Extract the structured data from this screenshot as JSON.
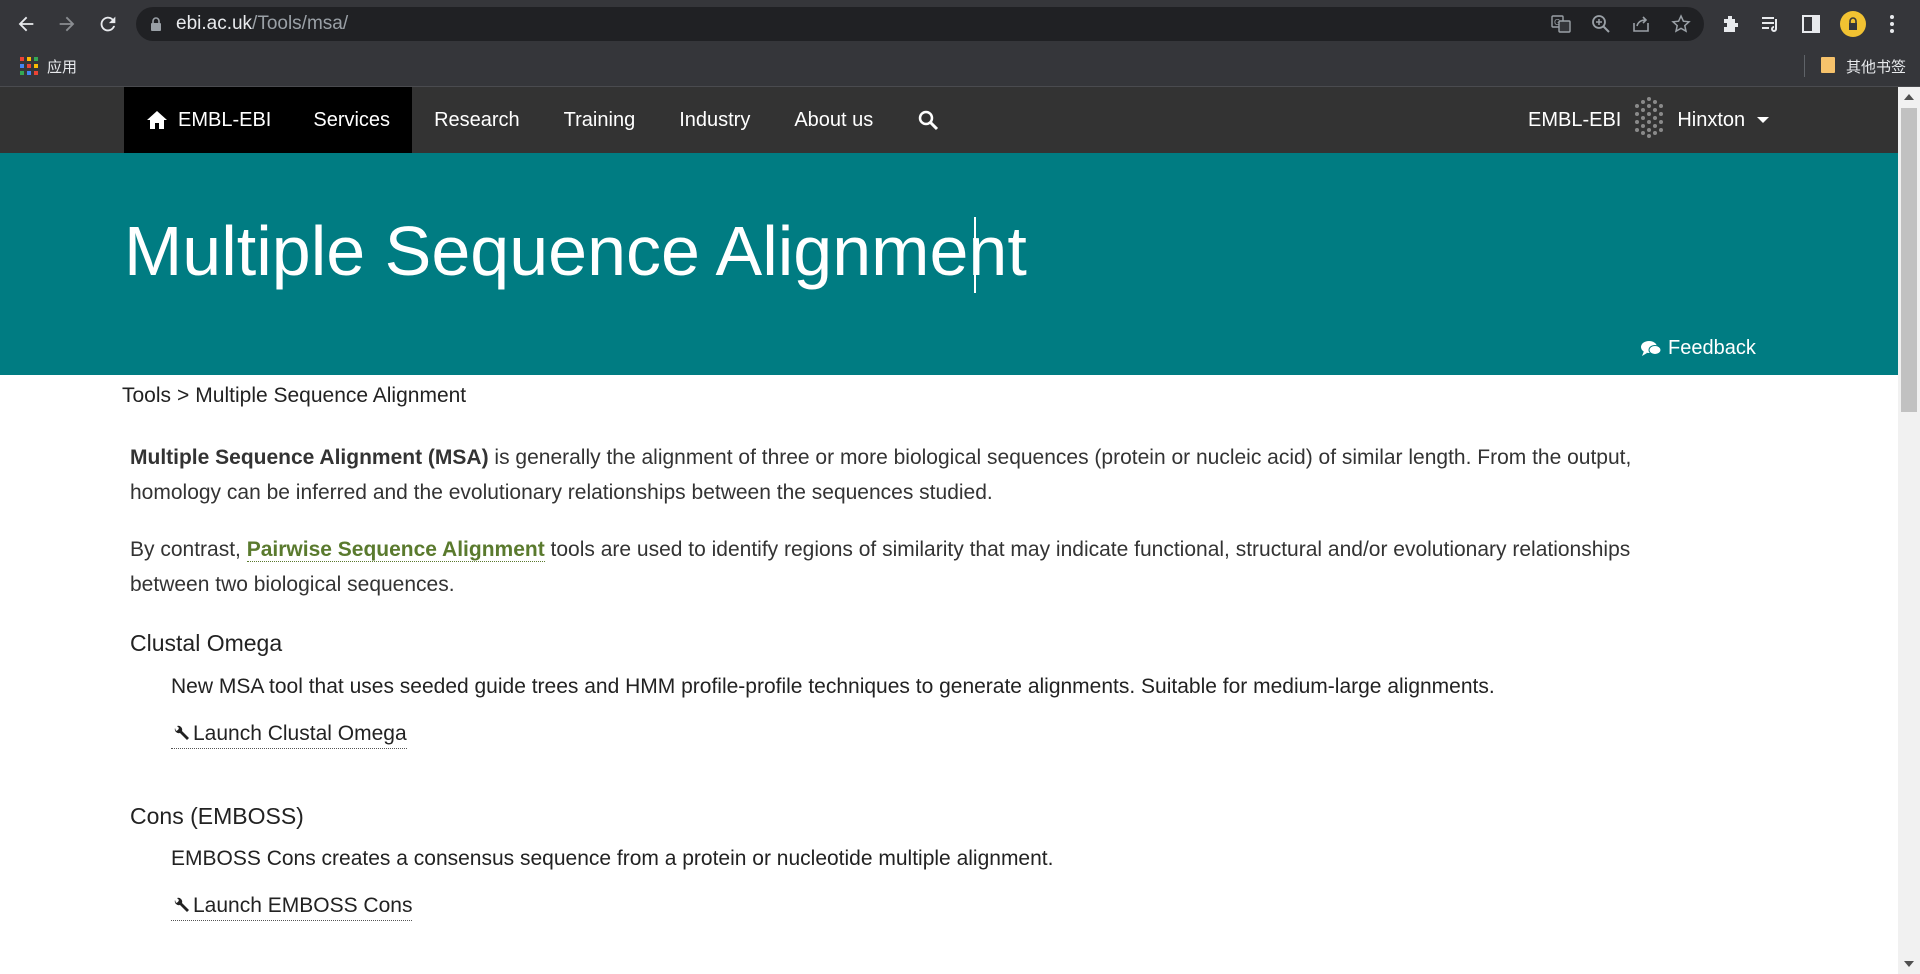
{
  "browser": {
    "url_domain": "ebi.ac.uk",
    "url_path": "/Tools/msa/",
    "bookmarks": {
      "apps_label": "应用",
      "other_bookmarks_label": "其他书签"
    }
  },
  "site_nav": {
    "items": [
      {
        "label": "EMBL-EBI"
      },
      {
        "label": "Services"
      },
      {
        "label": "Research"
      },
      {
        "label": "Training"
      },
      {
        "label": "Industry"
      },
      {
        "label": "About us"
      }
    ],
    "brand_label": "EMBL-EBI",
    "location_label": "Hinxton"
  },
  "hero": {
    "title": "Multiple Sequence Alignment",
    "feedback_label": "Feedback"
  },
  "breadcrumb": {
    "root": "Tools",
    "separator": ">",
    "current": "Multiple Sequence Alignment"
  },
  "content": {
    "intro_bold": "Multiple Sequence Alignment (MSA)",
    "intro_rest": " is generally the alignment of three or more biological sequences (protein or nucleic acid) of similar length. From the output, homology can be inferred and the evolutionary relationships between the sequences studied.",
    "contrast_prefix": "By contrast, ",
    "contrast_link": "Pairwise Sequence Alignment",
    "contrast_suffix": " tools are used to identify regions of similarity that may indicate functional, structural and/or evolutionary relationships between two biological sequences.",
    "tools": [
      {
        "name": "Clustal Omega",
        "description": "New MSA tool that uses seeded guide trees and HMM profile-profile techniques to generate alignments. Suitable for medium-large alignments.",
        "launch_label": "Launch Clustal Omega"
      },
      {
        "name": "Cons (EMBOSS)",
        "description": "EMBOSS Cons creates a consensus sequence from a protein or nucleotide multiple alignment.",
        "launch_label": "Launch EMBOSS Cons"
      }
    ]
  },
  "colors": {
    "hero_background": "#007c82",
    "nav_background": "#333333",
    "link_green": "#5a7a2e"
  }
}
